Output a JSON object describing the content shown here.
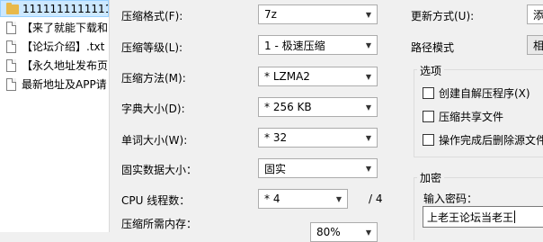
{
  "file_list": {
    "items": [
      {
        "name": "1111111111111",
        "type": "folder",
        "selected": true
      },
      {
        "name": "【来了就能下载和",
        "type": "file",
        "selected": false
      },
      {
        "name": "【论坛介绍】.txt",
        "type": "file",
        "selected": false
      },
      {
        "name": "【永久地址发布页",
        "type": "file",
        "selected": false
      },
      {
        "name": "最新地址及APP请",
        "type": "file",
        "selected": false
      }
    ]
  },
  "compression": {
    "format_label": "压缩格式(F):",
    "format_value": "7z",
    "level_label": "压缩等级(L):",
    "level_value": "1 - 极速压缩",
    "method_label": "压缩方法(M):",
    "method_value": "* LZMA2",
    "dict_label": "字典大小(D):",
    "dict_value": "* 256 KB",
    "word_label": "单词大小(W):",
    "word_value": "* 32",
    "solid_label": "固实数据大小：",
    "solid_value": "固实",
    "cpu_label": "CPU 线程数：",
    "cpu_value": "* 4",
    "cpu_max": "/ 4",
    "memory_label": "压缩所需内存：",
    "memory_value": "80%"
  },
  "update": {
    "mode_label": "更新方式(U):",
    "mode_value": "添加",
    "path_label": "路径模式",
    "path_value": "相对"
  },
  "options": {
    "title": "选项",
    "items": [
      "创建自解压程序(X)",
      "压缩共享文件",
      "操作完成后删除源文件"
    ]
  },
  "encryption": {
    "title": "加密",
    "password_label": "输入密码：",
    "password_value": "上老王论坛当老王"
  }
}
